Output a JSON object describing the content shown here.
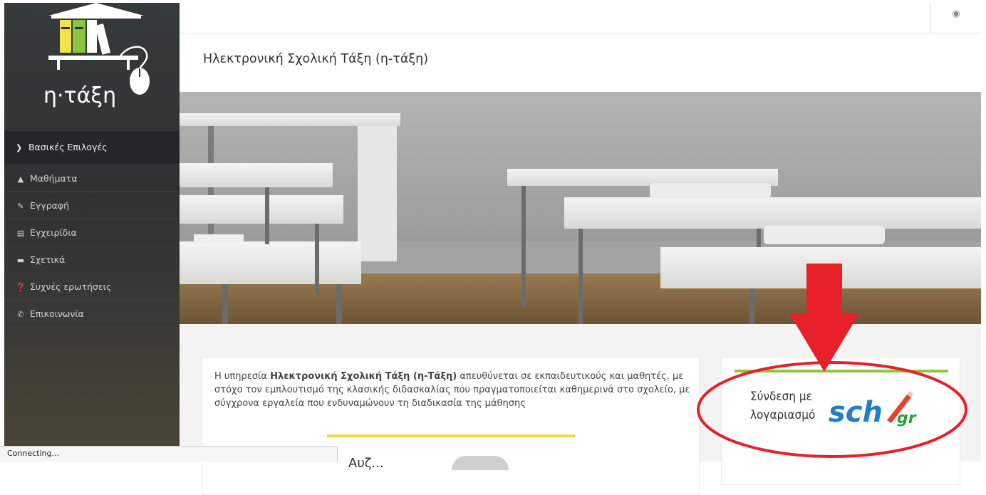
{
  "app": {
    "logo_text": "η·τάξη",
    "page_title": "Ηλεκτρονική Σχολική Τάξη (η-τάξη)"
  },
  "sidebar": {
    "section_label": "Βασικές Επιλογές",
    "items": [
      {
        "label": "Μαθήματα",
        "icon": "graduation-cap-icon"
      },
      {
        "label": "Εγγραφή",
        "icon": "edit-icon"
      },
      {
        "label": "Εγχειρίδια",
        "icon": "file-icon"
      },
      {
        "label": "Σχετικά",
        "icon": "credit-card-icon"
      },
      {
        "label": "Συχνές ερωτήσεις",
        "icon": "question-circle-icon"
      },
      {
        "label": "Επικοινωνία",
        "icon": "phone-icon"
      }
    ]
  },
  "topbar": {
    "language_icon": "globe-icon"
  },
  "intro": {
    "prefix": "Η υπηρεσία ",
    "bold": "Ηλεκτρονική Σχολική Τάξη (η-Τάξη)",
    "suffix": " απευθύνεται σε εκπαιδευτικούς και μαθητές, με στόχο τον εμπλουτισμό της κλασικής διδασκαλίας που πραγματοποιείται καθημερινά στο σχολείο, με σύγχρονα εργαλεία που ενδυναμώνουν τη διαδικασία της μάθησης",
    "partial_heading": "Αυζ..."
  },
  "login": {
    "line1": "Σύνδεση με",
    "line2": "λογαριασμό",
    "brand": "sch",
    "brand_suffix": "gr"
  },
  "status_bar": {
    "text": "Connecting..."
  },
  "colors": {
    "sidebar": "#2f3231",
    "accent_green": "#8cc63e",
    "accent_yellow": "#f5d64a",
    "annotation_red": "#e8202a"
  }
}
